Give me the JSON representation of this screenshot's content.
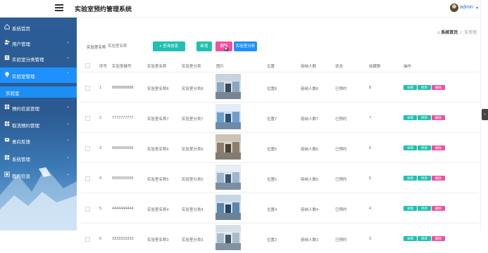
{
  "header": {
    "title": "实验室预约管理系统",
    "user": "admin",
    "user_caret": "▾"
  },
  "sidebar": {
    "items": [
      {
        "label": "系统首页",
        "icon": "home-icon"
      },
      {
        "label": "用户管理",
        "icon": "users-icon"
      },
      {
        "label": "实验室分类管理",
        "icon": "folder-icon"
      },
      {
        "label": "实验室管理",
        "icon": "lab-icon",
        "active": true
      },
      {
        "label": "实验室",
        "sub": true
      },
      {
        "label": "预约信息管理",
        "icon": "grid-icon"
      },
      {
        "label": "取消预约管理",
        "icon": "grid-icon"
      },
      {
        "label": "意向反馈",
        "icon": "feedback-icon"
      },
      {
        "label": "系统管理",
        "icon": "grid-icon"
      },
      {
        "label": "我的信息",
        "icon": "profile-icon"
      }
    ]
  },
  "breadcrumb": {
    "home": "系统首页",
    "separator": "/",
    "current": "实验室"
  },
  "search": {
    "label": "实验室名称",
    "placeholder": "实验室名称",
    "button": "查询信息"
  },
  "toolbar": {
    "add": "新增",
    "delete": "删除",
    "stats": "实验室分析"
  },
  "table": {
    "columns": [
      "序号",
      "实验室编号",
      "实验室名称",
      "实验室分类",
      "图片",
      "位置",
      "容纳人数",
      "状态",
      "收藏数",
      "操作"
    ],
    "rows": [
      {
        "index": "1",
        "code": "8888888888",
        "name": "实验室名称8",
        "category": "实验室分类8",
        "location": "位置8",
        "capacity": "容纳人数8",
        "status": "已预约",
        "favorites": "8"
      },
      {
        "index": "2",
        "code": "7777777777",
        "name": "实验室名称7",
        "category": "实验室分类7",
        "location": "位置7",
        "capacity": "容纳人数7",
        "status": "已预约",
        "favorites": "7"
      },
      {
        "index": "3",
        "code": "6666666666",
        "name": "实验室名称6",
        "category": "实验室分类6",
        "location": "位置6",
        "capacity": "容纳人数6",
        "status": "已预约",
        "favorites": "6"
      },
      {
        "index": "4",
        "code": "5555555555",
        "name": "实验室名称5",
        "category": "实验室分类5",
        "location": "位置5",
        "capacity": "容纳人数5",
        "status": "已预约",
        "favorites": "5"
      },
      {
        "index": "5",
        "code": "4444444444",
        "name": "实验室名称4",
        "category": "实验室分类4",
        "location": "位置4",
        "capacity": "容纳人数4",
        "status": "已预约",
        "favorites": "4"
      },
      {
        "index": "6",
        "code": "3333333333",
        "name": "实验室名称3",
        "category": "实验室分类3",
        "location": "位置3",
        "capacity": "容纳人数3",
        "status": "已预约",
        "favorites": "3"
      }
    ],
    "actions": {
      "detail": "详情",
      "edit": "修改",
      "delete": "删除"
    }
  },
  "colors": {
    "sidebar": "#2c5d96",
    "active": "#1e90ff",
    "teal": "#21c0b0",
    "pink": "#f050a0",
    "blue": "#1e90ff"
  }
}
